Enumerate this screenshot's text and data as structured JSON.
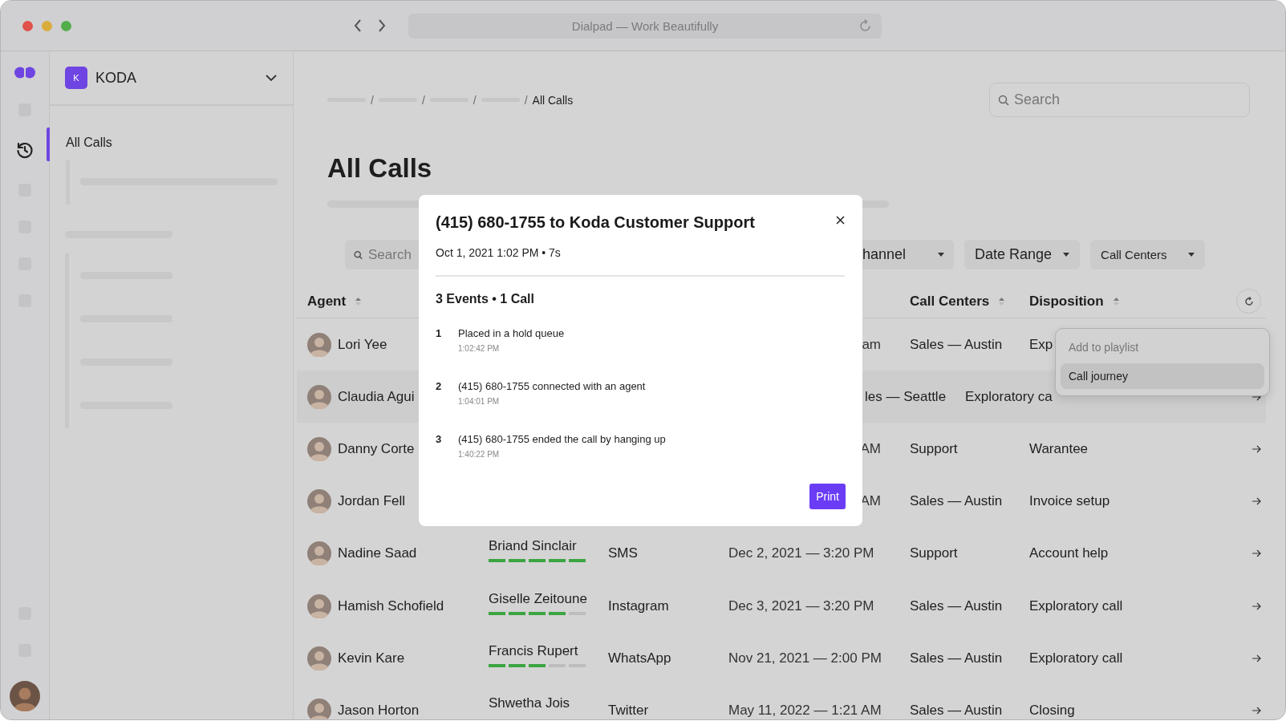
{
  "browser": {
    "address": "Dialpad — Work Beautifully"
  },
  "rail": {
    "top": [
      {
        "kind": "logo",
        "selected": false
      },
      {
        "kind": "placeholder",
        "selected": false
      },
      {
        "kind": "history",
        "selected": true
      },
      {
        "kind": "placeholder",
        "selected": false
      },
      {
        "kind": "placeholder",
        "selected": false
      },
      {
        "kind": "placeholder",
        "selected": false
      },
      {
        "kind": "placeholder",
        "selected": false
      }
    ],
    "bottom": [
      {
        "kind": "placeholder",
        "selected": false
      },
      {
        "kind": "placeholder",
        "selected": false
      },
      {
        "kind": "avatar",
        "selected": false
      }
    ]
  },
  "workspace": {
    "badge": "K",
    "name": "KODA"
  },
  "sidebar": {
    "items": [
      {
        "label": "All Calls"
      }
    ]
  },
  "breadcrumb": [
    {
      "kind": "placeholder"
    },
    {
      "kind": "separator",
      "text": "/"
    },
    {
      "kind": "placeholder"
    },
    {
      "kind": "separator",
      "text": "/"
    },
    {
      "kind": "placeholder"
    },
    {
      "kind": "separator",
      "text": "/"
    },
    {
      "kind": "placeholder"
    },
    {
      "kind": "separator",
      "text": "/"
    },
    {
      "kind": "current",
      "text": "All Calls"
    }
  ],
  "search": {
    "placeholder": "Search"
  },
  "page_title": "All Calls",
  "filters": {
    "search": {
      "placeholder": "Search"
    },
    "dropdowns": [
      {
        "label": "hannel",
        "cut": true
      },
      {
        "label": "Date Range",
        "cut": false
      },
      {
        "label": "Call Centers",
        "cut": false
      }
    ]
  },
  "table": {
    "columns": [
      {
        "label": "Agent"
      },
      {
        "label": "Call Centers"
      },
      {
        "label": "Disposition"
      }
    ],
    "rows": [
      {
        "agent": "Lori Yee",
        "date": "am",
        "call_center": "Sales — Austin",
        "disposition": "Exp",
        "hovered": false
      },
      {
        "agent": "Claudia Agui",
        "call_center": "les — Seattle",
        "disposition": "Exploratory ca",
        "hovered": true,
        "arrow": true
      },
      {
        "agent": "Danny Corte",
        "date": "AM",
        "call_center": "Support",
        "disposition": "Warantee",
        "hovered": false,
        "arrow": true
      },
      {
        "agent": "Jordan Fell",
        "date": "AM",
        "call_center": "Sales — Austin",
        "disposition": "Invoice setup",
        "hovered": false,
        "arrow": true
      },
      {
        "agent": "Nadine Saad",
        "supervisor": "Briand Sinclair",
        "level": 1,
        "channel": "SMS",
        "date": "Dec 2, 2021 — 3:20 PM",
        "call_center": "Support",
        "disposition": "Account help",
        "hovered": false,
        "arrow": true
      },
      {
        "agent": "Hamish Schofield",
        "supervisor": "Giselle Zeitoune",
        "level": 0.8,
        "channel": "Instagram",
        "date": "Dec 3, 2021 — 3:20 PM",
        "call_center": "Sales — Austin",
        "disposition": "Exploratory call",
        "hovered": false,
        "arrow": true
      },
      {
        "agent": "Kevin Kare",
        "supervisor": "Francis Rupert",
        "level": 0.6,
        "channel": "WhatsApp",
        "date": "Nov 21, 2021 — 2:00 PM",
        "call_center": "Sales — Austin",
        "disposition": "Exploratory call",
        "hovered": false,
        "arrow": true
      },
      {
        "agent": "Jason Horton",
        "supervisor": "Shwetha Jois",
        "channel": "Twitter",
        "date": "May 11, 2022 — 1:21 AM",
        "call_center": "Sales — Austin",
        "disposition": "Closing",
        "hovered": false,
        "arrow": true
      }
    ]
  },
  "menu": {
    "items": [
      {
        "label": "Add to playlist",
        "disabled": true,
        "selected": false
      },
      {
        "label": "Call journey",
        "disabled": false,
        "selected": true
      }
    ]
  },
  "dialog": {
    "title": "(415) 680-1755 to Koda Customer Support",
    "meta": "Oct 1, 2021 1:02 PM • 7s",
    "summary": "3 Events • 1 Call",
    "events": [
      {
        "number": "1",
        "text": "Placed in a hold queue",
        "time": "1:02:42 PM"
      },
      {
        "number": "2",
        "text": "(415) 680-1755 connected with an agent",
        "time": "1:04:01 PM"
      },
      {
        "number": "3",
        "text": "(415) 680-1755 ended the call by hanging up",
        "time": "1:40:22 PM"
      }
    ],
    "button": "Print"
  }
}
